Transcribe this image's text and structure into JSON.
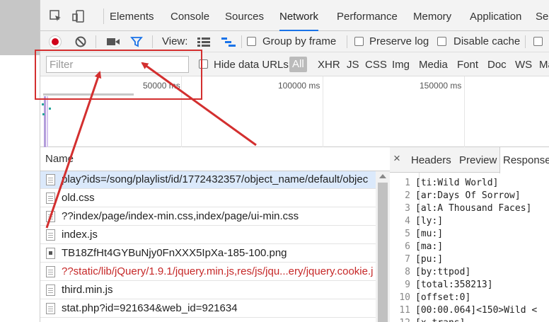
{
  "tabs": [
    "Elements",
    "Console",
    "Sources",
    "Network",
    "Performance",
    "Memory",
    "Application",
    "Se"
  ],
  "toolbar": {
    "view_label": "View:",
    "group_by_frame": "Group by frame",
    "preserve_log": "Preserve log",
    "disable_cache": "Disable cache"
  },
  "filter": {
    "placeholder": "Filter",
    "hide_data_urls": "Hide data URLs",
    "types": [
      "All",
      "XHR",
      "JS",
      "CSS",
      "Img",
      "Media",
      "Font",
      "Doc",
      "WS",
      "Ma"
    ]
  },
  "overview": {
    "ticks": [
      "50000 ms",
      "100000 ms",
      "150000 ms"
    ]
  },
  "requests": {
    "header": "Name",
    "rows": [
      {
        "name": "play?ids=/song/playlist/id/1772432357/object_name/default/objec",
        "type": "doc",
        "status": "selected"
      },
      {
        "name": "old.css",
        "type": "doc",
        "status": "normal"
      },
      {
        "name": "??index/page/index-min.css,index/page/ui-min.css",
        "type": "doc",
        "status": "normal"
      },
      {
        "name": "index.js",
        "type": "doc",
        "status": "normal"
      },
      {
        "name": "TB18ZfHt4GYBuNjy0FnXXX5IpXa-185-100.png",
        "type": "img",
        "status": "normal"
      },
      {
        "name": "??static/lib/jQuery/1.9.1/jquery.min.js,res/js/jqu...ery/jquery.cookie.j",
        "type": "doc",
        "status": "error"
      },
      {
        "name": "third.min.js",
        "type": "doc",
        "status": "normal"
      },
      {
        "name": "stat.php?id=921634&web_id=921634",
        "type": "doc",
        "status": "normal"
      }
    ]
  },
  "response_panel": {
    "close": "×",
    "tabs": [
      "Headers",
      "Preview",
      "Response"
    ],
    "lines": [
      {
        "n": "1",
        "t": "[ti:Wild World]"
      },
      {
        "n": "2",
        "t": "[ar:Days Of Sorrow]"
      },
      {
        "n": "3",
        "t": "[al:A Thousand Faces]"
      },
      {
        "n": "4",
        "t": "[ly:]"
      },
      {
        "n": "5",
        "t": "[mu:]"
      },
      {
        "n": "6",
        "t": "[ma:]"
      },
      {
        "n": "7",
        "t": "[pu:]"
      },
      {
        "n": "8",
        "t": "[by:ttpod]"
      },
      {
        "n": "9",
        "t": "[total:358213]"
      },
      {
        "n": "10",
        "t": "[offset:0]"
      },
      {
        "n": "11",
        "t": "[00:00.064]<150>Wild <"
      },
      {
        "n": "12",
        "t": "[x-trans]"
      }
    ]
  },
  "colors": {
    "accent": "#1a73e8",
    "record": "#d0021b",
    "error_text": "#c62828",
    "annotation": "#d32f2f",
    "selected_row": "#dbe9fb"
  }
}
